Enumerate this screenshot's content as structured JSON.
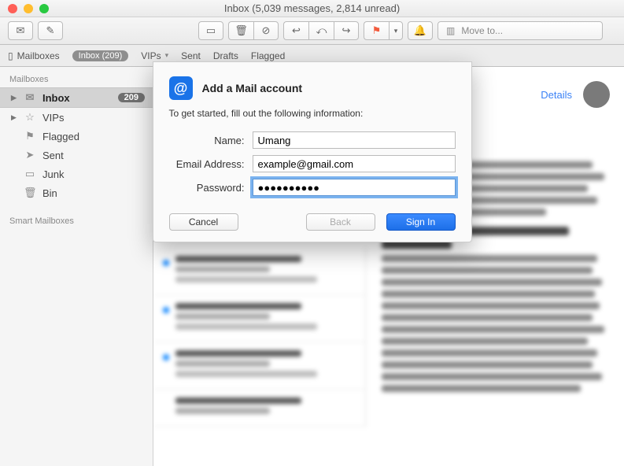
{
  "window": {
    "title": "Inbox (5,039 messages, 2,814 unread)"
  },
  "toolbar": {
    "moveto_placeholder": "Move to..."
  },
  "favbar": {
    "mailboxes_label": "Mailboxes",
    "inbox_pill": "Inbox (209)",
    "vips_label": "VIPs",
    "sent_label": "Sent",
    "drafts_label": "Drafts",
    "flagged_label": "Flagged"
  },
  "sidebar": {
    "header": "Mailboxes",
    "inbox": {
      "label": "Inbox",
      "badge": "209"
    },
    "vips": {
      "label": "VIPs"
    },
    "flagged": {
      "label": "Flagged"
    },
    "sent": {
      "label": "Sent"
    },
    "junk": {
      "label": "Junk"
    },
    "bin": {
      "label": "Bin"
    },
    "smart_header": "Smart Mailboxes"
  },
  "blur": {
    "details": "Details"
  },
  "modal": {
    "title": "Add a Mail account",
    "subtitle": "To get started, fill out the following information:",
    "name_label": "Name:",
    "name_value": "Umang",
    "email_label": "Email Address:",
    "email_value": "example@gmail.com",
    "password_label": "Password:",
    "password_value": "●●●●●●●●●●",
    "cancel": "Cancel",
    "back": "Back",
    "signin": "Sign In"
  }
}
